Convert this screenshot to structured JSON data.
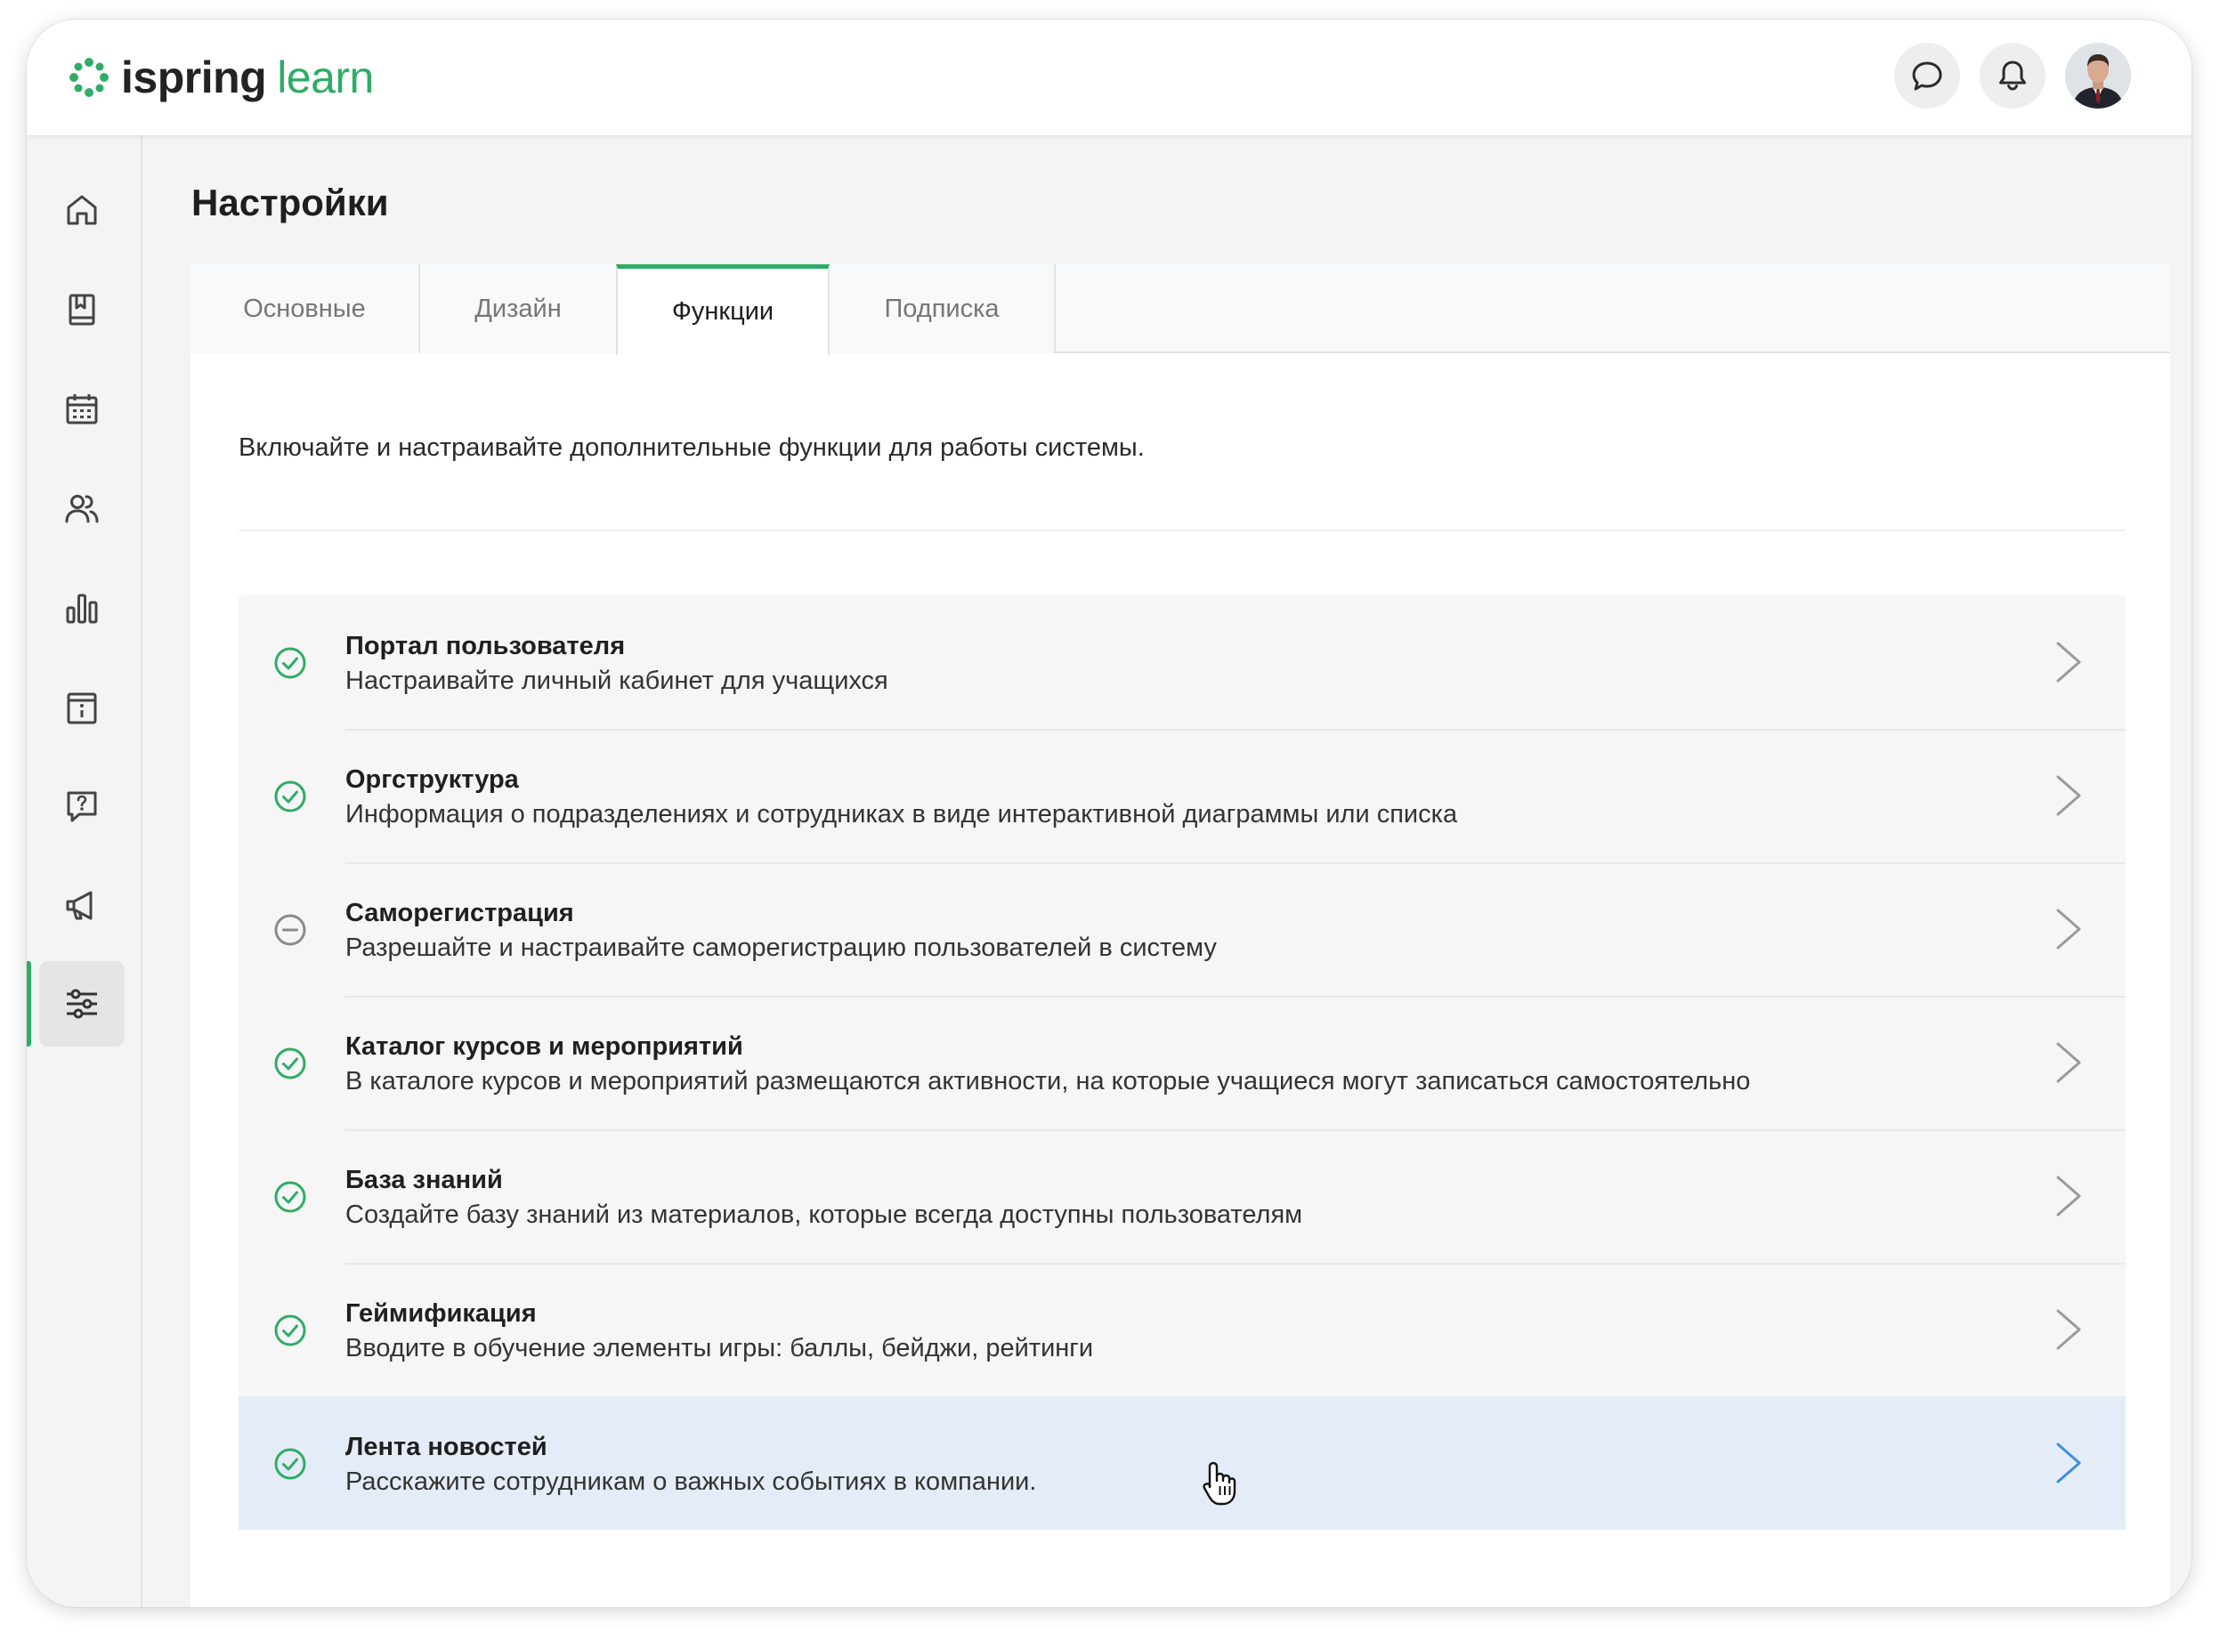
{
  "app": {
    "logo_word_1": "ispring",
    "logo_word_2": "learn"
  },
  "header": {
    "chat_icon": "chat-bubble-icon",
    "notifications_icon": "bell-icon",
    "avatar": "user-avatar"
  },
  "sidebar": {
    "items": [
      {
        "icon": "home-icon",
        "active": false
      },
      {
        "icon": "courses-book-icon",
        "active": false
      },
      {
        "icon": "calendar-icon",
        "active": false
      },
      {
        "icon": "users-icon",
        "active": false
      },
      {
        "icon": "reports-chart-icon",
        "active": false
      },
      {
        "icon": "info-board-icon",
        "active": false
      },
      {
        "icon": "help-question-icon",
        "active": false
      },
      {
        "icon": "megaphone-icon",
        "active": false
      },
      {
        "icon": "settings-sliders-icon",
        "active": true
      }
    ]
  },
  "page": {
    "title": "Настройки"
  },
  "tabs": [
    {
      "label": "Основные",
      "active": false
    },
    {
      "label": "Дизайн",
      "active": false
    },
    {
      "label": "Функции",
      "active": true
    },
    {
      "label": "Подписка",
      "active": false
    }
  ],
  "intro": "Включайте и настраивайте дополнительные функции для работы системы.",
  "features": [
    {
      "title": "Портал пользователя",
      "description": "Настраивайте личный кабинет для учащихся",
      "status": "enabled"
    },
    {
      "title": "Оргструктура",
      "description": "Информация о подразделениях и сотрудниках в виде интерактивной диаграммы или списка",
      "status": "enabled"
    },
    {
      "title": "Саморегистрация",
      "description": "Разрешайте и настраивайте саморегистрацию пользователей в систему",
      "status": "disabled"
    },
    {
      "title": "Каталог курсов и мероприятий",
      "description": "В каталоге курсов и мероприятий размещаются активности, на которые учащиеся могут записаться самостоятельно",
      "status": "enabled"
    },
    {
      "title": "База знаний",
      "description": "Создайте базу знаний из материалов, которые всегда доступны пользователям",
      "status": "enabled"
    },
    {
      "title": "Геймификация",
      "description": "Вводите в обучение элементы игры: баллы, бейджи, рейтинги",
      "status": "enabled"
    },
    {
      "title": "Лента новостей",
      "description": "Расскажите сотрудникам о важных событиях в компании.",
      "status": "enabled",
      "hovered": true
    }
  ],
  "colors": {
    "accent": "#2fac66",
    "hover_row": "#e4edf7",
    "hover_chevron": "#3d8fe0",
    "chevron": "#9a9a9a",
    "disabled_icon": "#8a8a8a"
  }
}
